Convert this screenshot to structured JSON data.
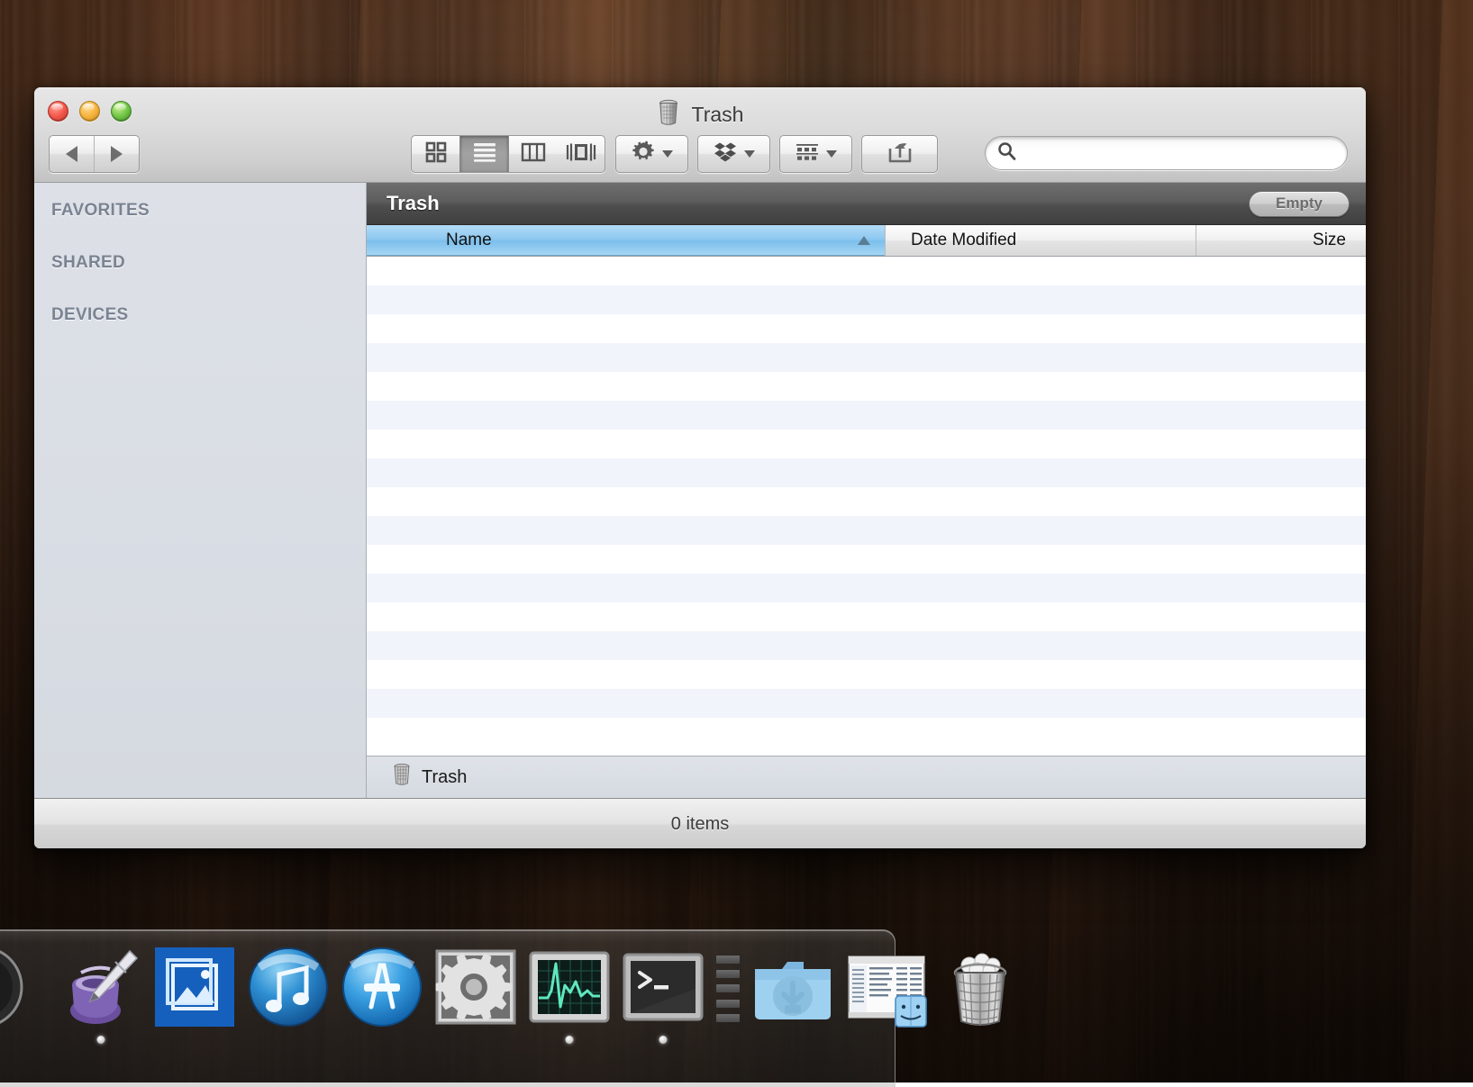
{
  "window": {
    "title": "Trash",
    "title_icon": "trash-icon",
    "traffic_lights": [
      {
        "name": "close-button",
        "color": "#f2584b"
      },
      {
        "name": "minimize-button",
        "color": "#f6b33d"
      },
      {
        "name": "zoom-button",
        "color": "#72c546"
      }
    ]
  },
  "toolbar": {
    "back_label": "Back",
    "forward_label": "Forward",
    "view_modes": [
      {
        "name": "icon-view",
        "icon": "grid-icon",
        "selected": false
      },
      {
        "name": "list-view",
        "icon": "list-icon",
        "selected": true
      },
      {
        "name": "column-view",
        "icon": "columns-icon",
        "selected": false
      },
      {
        "name": "coverflow-view",
        "icon": "coverflow-icon",
        "selected": false
      }
    ],
    "action_menu": {
      "name": "action-menu",
      "icon": "gear-icon"
    },
    "dropbox_menu": {
      "name": "dropbox-menu",
      "icon": "dropbox-icon"
    },
    "arrange_menu": {
      "name": "arrange-menu",
      "icon": "arrange-icon"
    },
    "share_button": {
      "name": "share-button",
      "icon": "share-icon"
    },
    "search": {
      "icon": "search-icon",
      "value": "",
      "placeholder": ""
    }
  },
  "sidebar": {
    "sections": [
      {
        "label": "FAVORITES",
        "items": []
      },
      {
        "label": "SHARED",
        "items": []
      },
      {
        "label": "DEVICES",
        "items": []
      }
    ]
  },
  "pane": {
    "title": "Trash",
    "empty_button_label": "Empty"
  },
  "columns": [
    {
      "label": "Name",
      "sorted": true,
      "sort_direction": "ascending"
    },
    {
      "label": "Date Modified",
      "sorted": false
    },
    {
      "label": "Size",
      "sorted": false
    }
  ],
  "file_list": {
    "rows": [],
    "empty_row_count": 17
  },
  "path_bar": {
    "icon": "trash-icon",
    "label": "Trash"
  },
  "status_bar": {
    "item_count_label": "0 items"
  },
  "dock": {
    "items": [
      {
        "name": "dock-item-partial-app",
        "label": "",
        "icon": "circle-b-icon",
        "running": false
      },
      {
        "name": "dock-item-textedit",
        "label": "TextEdit",
        "icon": "inkwell-pen-icon",
        "running": true
      },
      {
        "name": "dock-item-iphoto",
        "label": "iPhoto",
        "icon": "photo-icon",
        "running": false
      },
      {
        "name": "dock-item-itunes",
        "label": "iTunes",
        "icon": "music-note-icon",
        "running": false
      },
      {
        "name": "dock-item-app-store",
        "label": "App Store",
        "icon": "app-store-icon",
        "running": false
      },
      {
        "name": "dock-item-system-preferences",
        "label": "System Preferences",
        "icon": "gears-icon",
        "running": false
      },
      {
        "name": "dock-item-activity-monitor",
        "label": "Activity Monitor",
        "icon": "ekg-monitor-icon",
        "running": true
      },
      {
        "name": "dock-item-terminal",
        "label": "Terminal",
        "icon": "terminal-icon",
        "running": true
      },
      {
        "name": "dock-separator",
        "label": "",
        "icon": "dock-separator-icon",
        "running": false
      },
      {
        "name": "dock-item-downloads",
        "label": "Downloads",
        "icon": "downloads-folder-icon",
        "running": false
      },
      {
        "name": "dock-item-finder-stack",
        "label": "Finder Window",
        "icon": "finder-window-icon",
        "running": false
      },
      {
        "name": "dock-item-trash",
        "label": "Trash",
        "icon": "trash-full-icon",
        "running": false
      }
    ]
  }
}
